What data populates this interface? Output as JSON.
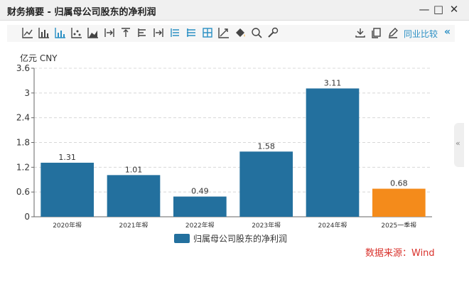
{
  "window": {
    "title": "财务摘要 - 归属母公司股东的净利润"
  },
  "toolbar": {
    "icons": [
      "line-chart-icon",
      "bar-chart-icon",
      "column-chart-icon",
      "scatter-chart-icon",
      "area-chart-icon",
      "step-left-icon",
      "top-align-icon",
      "middle-align-icon",
      "step-right-icon",
      "list-icon",
      "list-alt-icon",
      "grid-icon",
      "trend-icon",
      "fill-icon",
      "zoom-icon",
      "settings-icon"
    ],
    "right_icons": [
      "download-icon",
      "copy-icon",
      "edit-icon"
    ],
    "compare_label": "同业比较"
  },
  "unit_label": "亿元 CNY",
  "source_text": "数据来源：Wind",
  "chart_data": {
    "type": "bar",
    "categories": [
      "2020年报",
      "2021年报",
      "2022年报",
      "2023年报",
      "2024年报",
      "2025一季报"
    ],
    "series": [
      {
        "name": "归属母公司股东的净利润",
        "values": [
          1.31,
          1.01,
          0.49,
          1.58,
          3.11,
          0.68
        ]
      }
    ],
    "bar_colors": [
      "#23709e",
      "#23709e",
      "#23709e",
      "#23709e",
      "#23709e",
      "#f48b1b"
    ],
    "ylim": [
      0,
      3.6
    ],
    "yticks": [
      "0",
      "0.6",
      "1.2",
      "1.8",
      "2.4",
      "3",
      "3.6"
    ],
    "data_labels": [
      "1.31",
      "1.01",
      "0.49",
      "1.58",
      "3.11",
      "0.68"
    ],
    "grid": true,
    "legend_position": "bottom"
  }
}
